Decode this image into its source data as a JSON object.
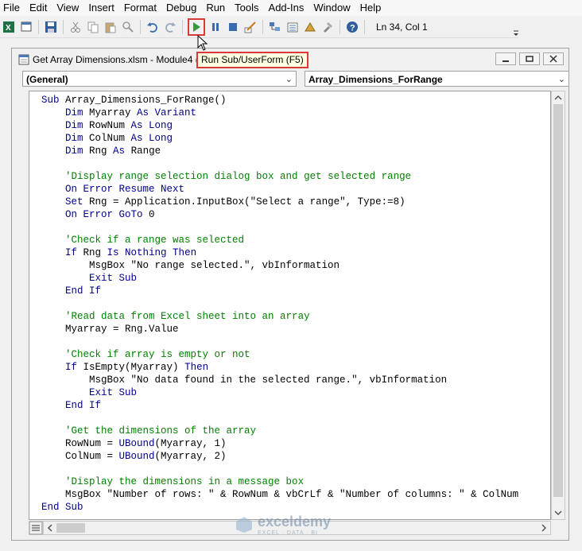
{
  "menu": [
    "File",
    "Edit",
    "View",
    "Insert",
    "Format",
    "Debug",
    "Run",
    "Tools",
    "Add-Ins",
    "Window",
    "Help"
  ],
  "toolbar": {
    "status": "Ln 34, Col 1",
    "icons": [
      "excel-view-icon",
      "insert-module-icon",
      "save-icon",
      "cut-icon",
      "copy-icon",
      "paste-icon",
      "find-icon",
      "undo-icon",
      "redo-icon",
      "run-icon",
      "break-icon",
      "reset-icon",
      "design-mode-icon",
      "project-explorer-icon",
      "properties-icon",
      "object-browser-icon",
      "toolbox-icon",
      "help-icon"
    ]
  },
  "tooltip": "Run Sub/UserForm (F5)",
  "window": {
    "title": "Get Array Dimensions.xlsm - Module4 (",
    "buttons": [
      "minimize-icon",
      "restore-icon",
      "close-icon"
    ]
  },
  "combos": {
    "object": "(General)",
    "procedure": "Array_Dimensions_ForRange"
  },
  "code_lines": [
    [
      [
        "kw",
        "Sub"
      ],
      [
        "t",
        " Array_Dimensions_ForRange()"
      ]
    ],
    [
      [
        "t",
        "    "
      ],
      [
        "kw",
        "Dim"
      ],
      [
        "t",
        " Myarray "
      ],
      [
        "kw",
        "As Variant"
      ]
    ],
    [
      [
        "t",
        "    "
      ],
      [
        "kw",
        "Dim"
      ],
      [
        "t",
        " RowNum "
      ],
      [
        "kw",
        "As Long"
      ]
    ],
    [
      [
        "t",
        "    "
      ],
      [
        "kw",
        "Dim"
      ],
      [
        "t",
        " ColNum "
      ],
      [
        "kw",
        "As Long"
      ]
    ],
    [
      [
        "t",
        "    "
      ],
      [
        "kw",
        "Dim"
      ],
      [
        "t",
        " Rng "
      ],
      [
        "kw",
        "As"
      ],
      [
        "t",
        " Range"
      ]
    ],
    [
      [
        "t",
        ""
      ]
    ],
    [
      [
        "t",
        "    "
      ],
      [
        "cm",
        "'Display range selection dialog box and get selected range"
      ]
    ],
    [
      [
        "t",
        "    "
      ],
      [
        "kw",
        "On Error Resume Next"
      ]
    ],
    [
      [
        "t",
        "    "
      ],
      [
        "kw",
        "Set"
      ],
      [
        "t",
        " Rng = Application.InputBox(\"Select a range\", Type:=8)"
      ]
    ],
    [
      [
        "t",
        "    "
      ],
      [
        "kw",
        "On Error GoTo"
      ],
      [
        "t",
        " 0"
      ]
    ],
    [
      [
        "t",
        ""
      ]
    ],
    [
      [
        "t",
        "    "
      ],
      [
        "cm",
        "'Check if a range was selected"
      ]
    ],
    [
      [
        "t",
        "    "
      ],
      [
        "kw",
        "If"
      ],
      [
        "t",
        " Rng "
      ],
      [
        "kw",
        "Is Nothing Then"
      ]
    ],
    [
      [
        "t",
        "        MsgBox \"No range selected.\", vbInformation"
      ]
    ],
    [
      [
        "t",
        "        "
      ],
      [
        "kw",
        "Exit Sub"
      ]
    ],
    [
      [
        "t",
        "    "
      ],
      [
        "kw",
        "End If"
      ]
    ],
    [
      [
        "t",
        ""
      ]
    ],
    [
      [
        "t",
        "    "
      ],
      [
        "cm",
        "'Read data from Excel sheet into an array"
      ]
    ],
    [
      [
        "t",
        "    Myarray = Rng.Value"
      ]
    ],
    [
      [
        "t",
        ""
      ]
    ],
    [
      [
        "t",
        "    "
      ],
      [
        "cm",
        "'Check if array is empty or not"
      ]
    ],
    [
      [
        "t",
        "    "
      ],
      [
        "kw",
        "If"
      ],
      [
        "t",
        " IsEmpty(Myarray) "
      ],
      [
        "kw",
        "Then"
      ]
    ],
    [
      [
        "t",
        "        MsgBox \"No data found in the selected range.\", vbInformation"
      ]
    ],
    [
      [
        "t",
        "        "
      ],
      [
        "kw",
        "Exit Sub"
      ]
    ],
    [
      [
        "t",
        "    "
      ],
      [
        "kw",
        "End If"
      ]
    ],
    [
      [
        "t",
        ""
      ]
    ],
    [
      [
        "t",
        "    "
      ],
      [
        "cm",
        "'Get the dimensions of the array"
      ]
    ],
    [
      [
        "t",
        "    RowNum = "
      ],
      [
        "kw",
        "UBound"
      ],
      [
        "t",
        "(Myarray, 1)"
      ]
    ],
    [
      [
        "t",
        "    ColNum = "
      ],
      [
        "kw",
        "UBound"
      ],
      [
        "t",
        "(Myarray, 2)"
      ]
    ],
    [
      [
        "t",
        ""
      ]
    ],
    [
      [
        "t",
        "    "
      ],
      [
        "cm",
        "'Display the dimensions in a message box"
      ]
    ],
    [
      [
        "t",
        "    MsgBox \"Number of rows: \" & RowNum & vbCrLf & \"Number of columns: \" & ColNum"
      ]
    ],
    [
      [
        "kw",
        "End Sub"
      ]
    ]
  ],
  "watermark": {
    "name": "exceldemy",
    "tag": "EXCEL · DATA · BI"
  },
  "colors": {
    "keyword": "#00008b",
    "comment": "#008000",
    "highlight": "#d93a3a",
    "tooltip_bg": "#ffffe1"
  }
}
